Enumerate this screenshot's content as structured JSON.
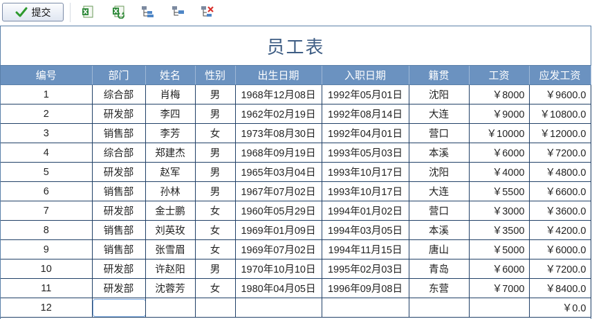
{
  "toolbar": {
    "submit_label": "提交",
    "icons": [
      "excel-export-icon",
      "excel-refresh-icon",
      "add-row-icon",
      "insert-row-icon",
      "delete-row-icon"
    ]
  },
  "grid": {
    "title": "员工表",
    "columns": [
      "编号",
      "部门",
      "姓名",
      "性别",
      "出生日期",
      "入职日期",
      "籍贯",
      "工资",
      "应发工资"
    ],
    "rows": [
      [
        "1",
        "综合部",
        "肖梅",
        "男",
        "1968年12月08日",
        "1992年05月01日",
        "沈阳",
        "￥8000",
        "￥9600.0"
      ],
      [
        "2",
        "研发部",
        "李四",
        "男",
        "1962年02月19日",
        "1992年08月14日",
        "大连",
        "￥9000",
        "￥10800.0"
      ],
      [
        "3",
        "销售部",
        "李芳",
        "女",
        "1973年08月30日",
        "1992年04月01日",
        "营口",
        "￥10000",
        "￥12000.0"
      ],
      [
        "4",
        "综合部",
        "郑建杰",
        "男",
        "1968年09月19日",
        "1993年05月03日",
        "本溪",
        "￥6000",
        "￥7200.0"
      ],
      [
        "5",
        "研发部",
        "赵军",
        "男",
        "1965年03月04日",
        "1993年10月17日",
        "沈阳",
        "￥4000",
        "￥4800.0"
      ],
      [
        "6",
        "销售部",
        "孙林",
        "男",
        "1967年07月02日",
        "1993年10月17日",
        "大连",
        "￥5500",
        "￥6600.0"
      ],
      [
        "7",
        "研发部",
        "金士鹏",
        "女",
        "1960年05月29日",
        "1994年01月02日",
        "营口",
        "￥3000",
        "￥3600.0"
      ],
      [
        "8",
        "销售部",
        "刘英玫",
        "女",
        "1969年01月09日",
        "1994年03月05日",
        "本溪",
        "￥3500",
        "￥4200.0"
      ],
      [
        "9",
        "销售部",
        "张雪眉",
        "女",
        "1969年07月02日",
        "1994年11月15日",
        "唐山",
        "￥5000",
        "￥6000.0"
      ],
      [
        "10",
        "研发部",
        "许赵阳",
        "男",
        "1970年10月10日",
        "1995年02月03日",
        "青岛",
        "￥6000",
        "￥7200.0"
      ],
      [
        "11",
        "研发部",
        "沈蓉芳",
        "女",
        "1980年04月05日",
        "1996年09月08日",
        "东营",
        "￥7000",
        "￥8400.0"
      ],
      [
        "12",
        "",
        "",
        "",
        "",
        "",
        "",
        "",
        "￥0.0"
      ]
    ]
  },
  "colors": {
    "header_bg": "#6b92c0",
    "title_text": "#3e5d84",
    "grid_line": "#1f3f66"
  }
}
